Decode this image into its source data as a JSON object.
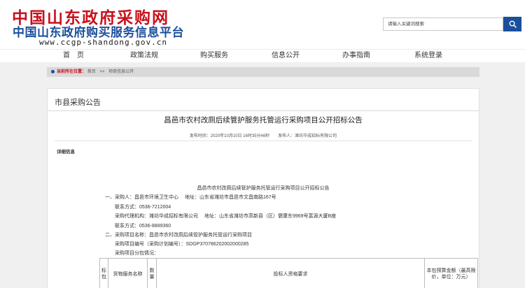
{
  "header": {
    "logo_cn": "中国山东政府采购网",
    "logo_sub": "中国山东政府购买服务信息平台",
    "logo_url": "www.ccgp-shandong.gov.cn"
  },
  "search": {
    "value": "请输入关键词搜索"
  },
  "nav": {
    "items": [
      "首　页",
      "政策法规",
      "购买服务",
      "信息公开",
      "办事指南",
      "系统登录"
    ]
  },
  "breadcrumb": {
    "label": "当前所在位置：",
    "items": [
      "首页",
      "项目信息公开"
    ],
    "separator": ">>"
  },
  "panel": {
    "title": "市县采购公告",
    "announcement_title": "昌邑市农村改厕后续管护服务托管运行采购项目公开招标公告",
    "publish_info": "发布时间：2020年10月10日 16时35分46秒　　发布人：潍坊华成招标有限公司",
    "detail_label": "详细信息"
  },
  "document": {
    "title": "昌邑市农村改厕后续管护服务托管运行采购项目公开招标公告",
    "lines": [
      "一、采购人：昌邑市环境卫生中心　 地址：山东省潍坊市昌邑市文昌南路167号",
      "联系方式：0536-7212004",
      "采购代理机构：潍坊华成招标有限公司　 地址：山东省潍坊市高新县（区）健康东9969号富源大厦B座",
      "联系方式：0536-8889360",
      "二、采购项目名称：昌邑市农村改厕后续管护服务托管运行采购项目",
      "采购项目编号（采购计划编号）：SDGP370786202002000285",
      "采购项目分包情况："
    ]
  },
  "table": {
    "col_package": "标包",
    "col_goods": "货物服务名称",
    "col_qty": "数量",
    "col_qualification": "投标人资格要求",
    "col_budget": "本包预算金额（最高限价，单位：万元）"
  },
  "colors": {
    "brand_red": "#c8101c",
    "brand_blue": "#1a4f9c"
  },
  "icons": {
    "search": "search-icon"
  }
}
